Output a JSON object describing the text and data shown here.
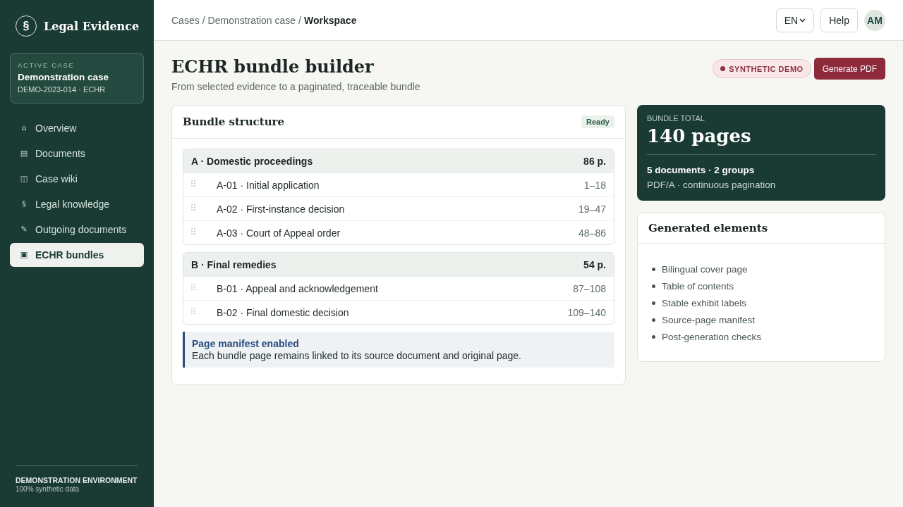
{
  "sidebar": {
    "brand": {
      "mark": "§",
      "name": "Legal Evidence"
    },
    "active_case": {
      "label": "ACTIVE CASE",
      "name": "Demonstration case",
      "reference": "DEMO-2023-014 · ECHR"
    },
    "nav_items": [
      {
        "icon": "⌂",
        "label": "Overview",
        "selected": false
      },
      {
        "icon": "▤",
        "label": "Documents",
        "selected": false
      },
      {
        "icon": "◫",
        "label": "Case wiki",
        "selected": false
      },
      {
        "icon": "§",
        "label": "Legal knowledge",
        "selected": false
      },
      {
        "icon": "✎",
        "label": "Outgoing documents",
        "selected": false
      },
      {
        "icon": "▣",
        "label": "ECHR bundles",
        "selected": true
      }
    ],
    "footer": {
      "title": "DEMONSTRATION ENVIRONMENT",
      "note": "100% synthetic data"
    }
  },
  "top_bar": {
    "breadcrumb": {
      "separator": "/",
      "items": [
        {
          "label": "Cases",
          "current": false
        },
        {
          "label": "Demonstration case",
          "current": false
        },
        {
          "label": "Workspace",
          "current": true
        }
      ]
    },
    "language": "EN",
    "help": "Help",
    "avatar": "AM"
  },
  "page_header": {
    "title": "ECHR bundle builder",
    "subtitle": "From selected evidence to a paginated, traceable bundle",
    "badge": "SYNTHETIC DEMO",
    "action": "Generate PDF"
  },
  "bundle_structure": {
    "title": "Bundle structure",
    "status": "Ready",
    "groups": [
      {
        "label": "A · Domestic proceedings",
        "pages": "86 p.",
        "documents": [
          {
            "label": "A-01 · Initial application",
            "range": "1–18"
          },
          {
            "label": "A-02 · First-instance decision",
            "range": "19–47"
          },
          {
            "label": "A-03 · Court of Appeal order",
            "range": "48–86"
          }
        ]
      },
      {
        "label": "B · Final remedies",
        "pages": "54 p.",
        "documents": [
          {
            "label": "B-01 · Appeal and acknowledgement",
            "range": "87–108"
          },
          {
            "label": "B-02 · Final domestic decision",
            "range": "109–140"
          }
        ]
      }
    ],
    "note": {
      "title": "Page manifest enabled",
      "text": "Each bundle page remains linked to its source document and original page."
    }
  },
  "bundle_total": {
    "label": "BUNDLE TOTAL",
    "value": "140 pages",
    "summary": "5 documents · 2 groups",
    "format": "PDF/A · continuous pagination"
  },
  "generated_elements": {
    "title": "Generated elements",
    "items": [
      "Bilingual cover page",
      "Table of contents",
      "Stable exhibit labels",
      "Source-page manifest",
      "Post-generation checks"
    ]
  }
}
